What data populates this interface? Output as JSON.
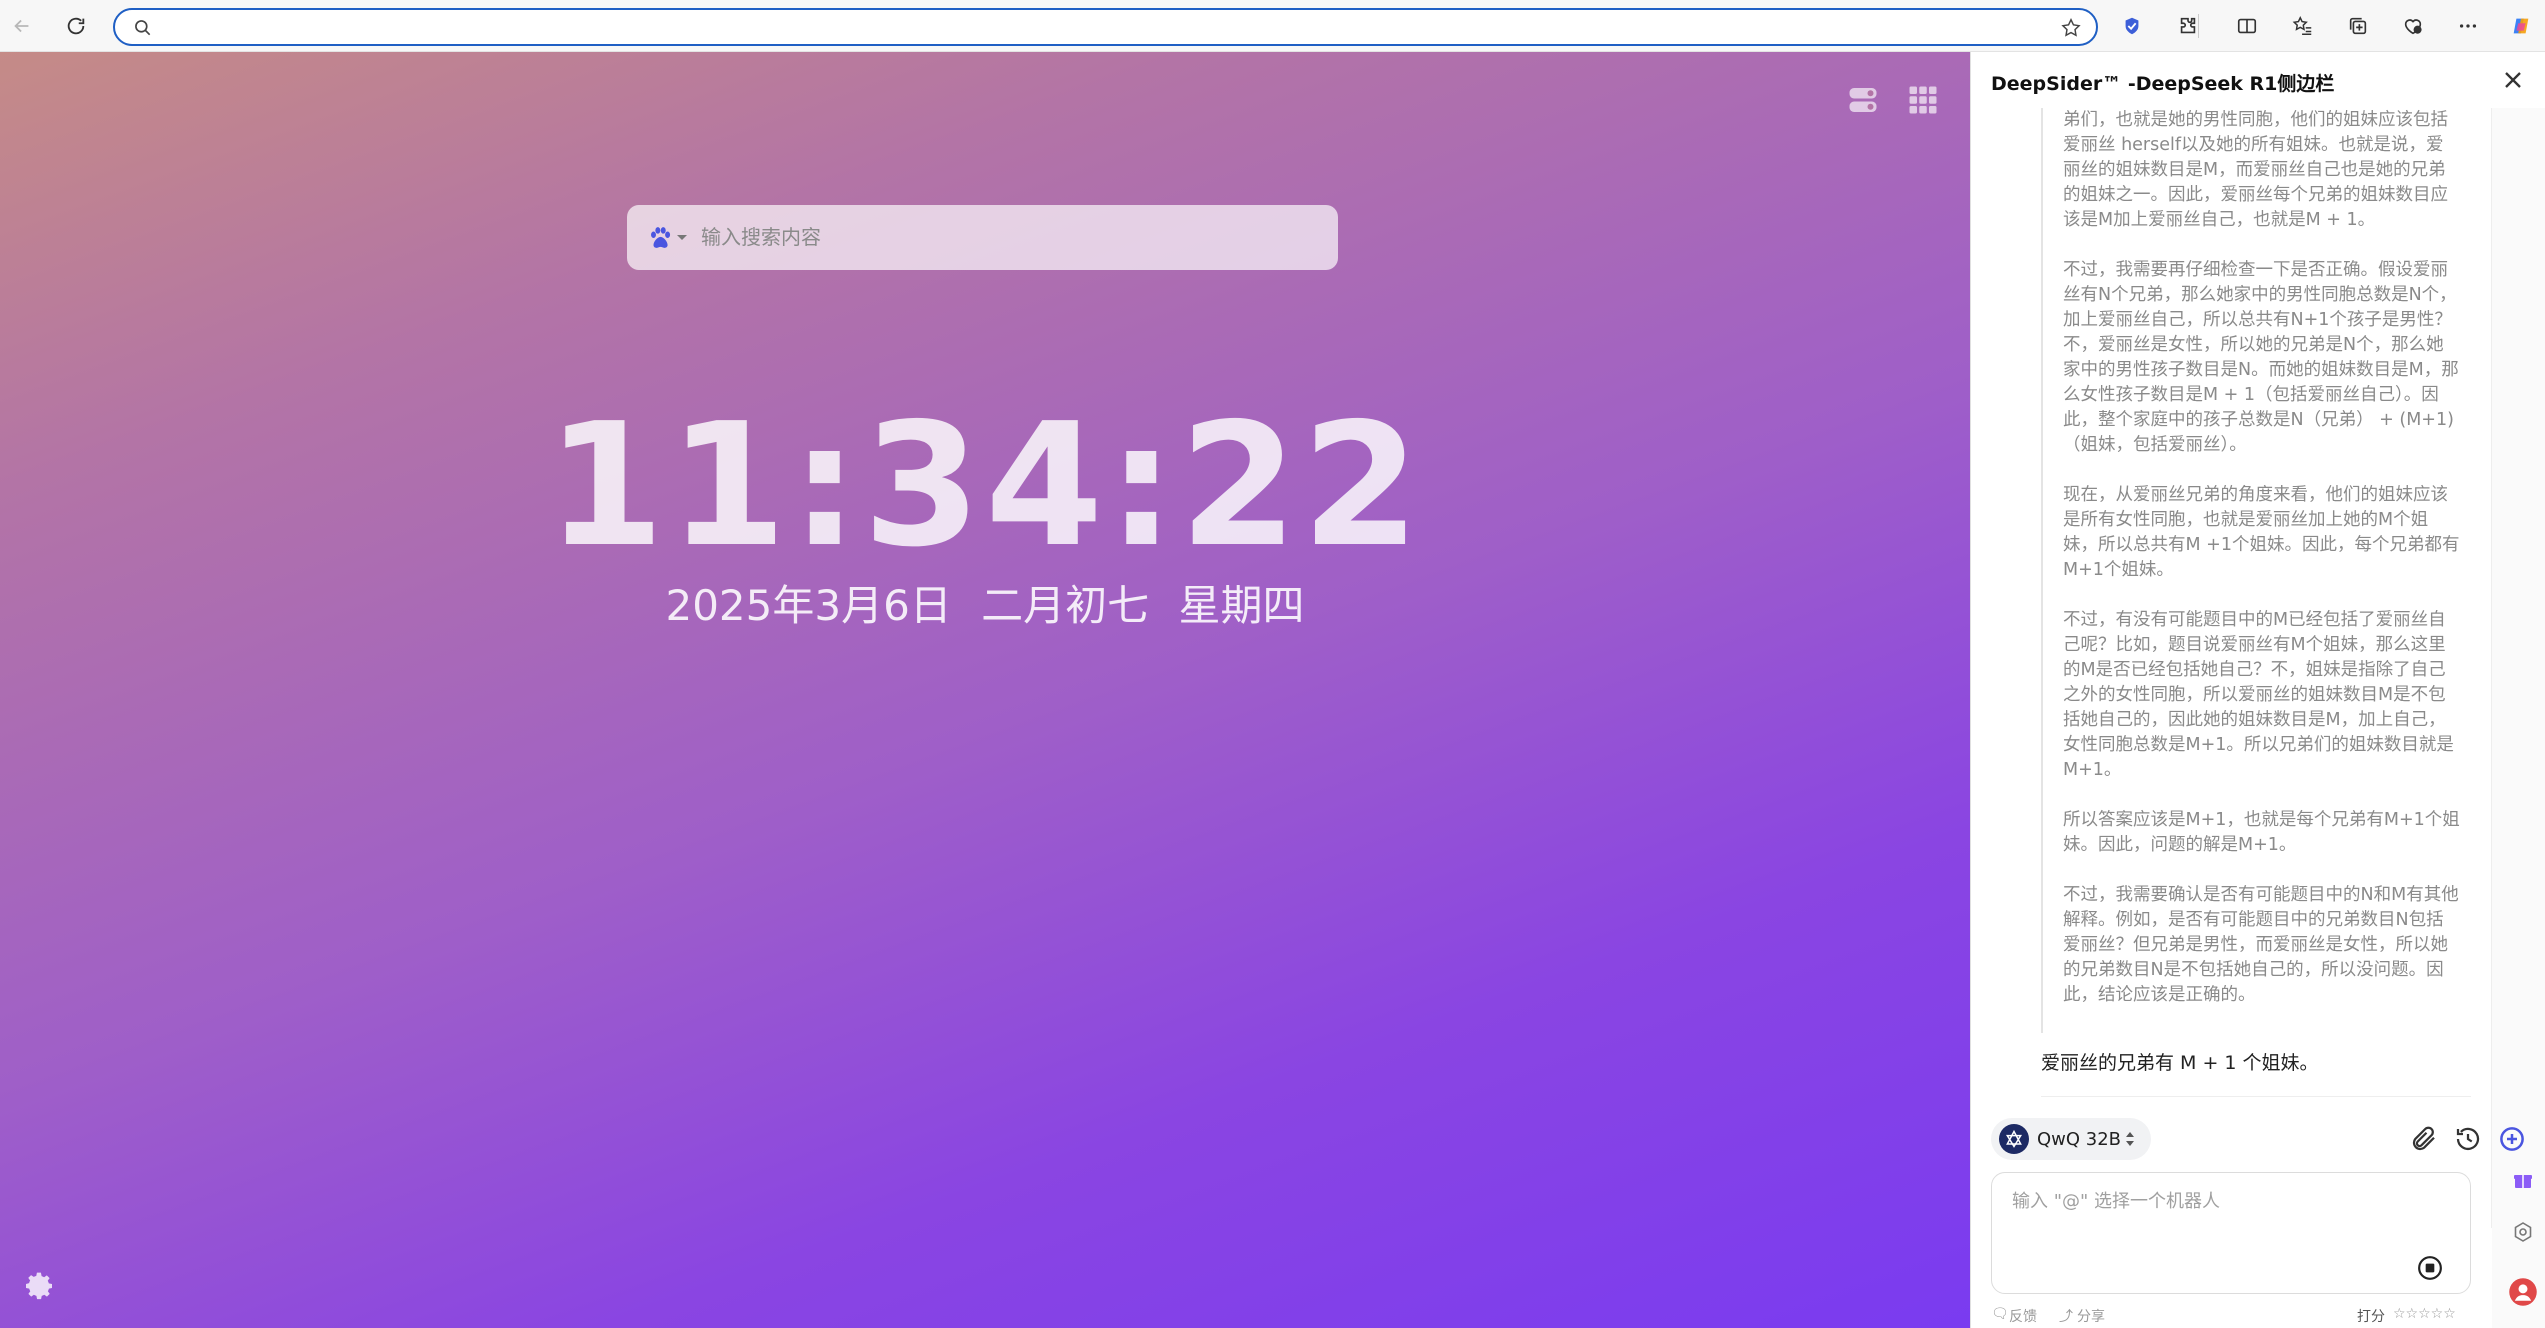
{
  "browser": {
    "address_value": "",
    "address_placeholder": ""
  },
  "newtab": {
    "search_placeholder": "输入搜索内容",
    "clock": "11:34:22",
    "date": "2025年3月6日 二月初七 星期四"
  },
  "panel": {
    "title": "DeepSider™ -DeepSeek R1侧边栏",
    "thinking_paragraphs": [
      "弟们，也就是她的男性同胞，他们的姐妹应该包括爱丽丝 herself以及她的所有姐妹。也就是说，爱丽丝的姐妹数目是M，而爱丽丝自己也是她的兄弟的姐妹之一。因此，爱丽丝每个兄弟的姐妹数目应该是M加上爱丽丝自己，也就是M + 1。",
      "不过，我需要再仔细检查一下是否正确。假设爱丽丝有N个兄弟，那么她家中的男性同胞总数是N个，加上爱丽丝自己，所以总共有N+1个孩子是男性？不，爱丽丝是女性，所以她的兄弟是N个，那么她家中的男性孩子数目是N。而她的姐妹数目是M，那么女性孩子数目是M + 1（包括爱丽丝自己）。因此，整个家庭中的孩子总数是N（兄弟） + (M+1)（姐妹，包括爱丽丝）。",
      "现在，从爱丽丝兄弟的角度来看，他们的姐妹应该是所有女性同胞，也就是爱丽丝加上她的M个姐妹，所以总共有M +1个姐妹。因此，每个兄弟都有M+1个姐妹。",
      "不过，有没有可能题目中的M已经包括了爱丽丝自己呢？比如，题目说爱丽丝有M个姐妹，那么这里的M是否已经包括她自己？不，姐妹是指除了自己之外的女性同胞，所以爱丽丝的姐妹数目M是不包括她自己的，因此她的姐妹数目是M，加上自己，女性同胞总数是M+1。所以兄弟们的姐妹数目就是M+1。",
      "所以答案应该是M+1，也就是每个兄弟有M+1个姐妹。因此，问题的解是M+1。",
      "不过，我需要确认是否有可能题目中的N和M有其他解释。例如，是否有可能题目中的兄弟数目N包括爱丽丝？但兄弟是男性，而爱丽丝是女性，所以她的兄弟数目N是不包括她自己的，所以没问题。因此，结论应该是正确的。"
    ],
    "answer": "爱丽丝的兄弟有 M + 1 个姐妹。",
    "model_name": "QwQ 32B",
    "input_placeholder": "输入 \"@\" 选择一个机器人",
    "footer": {
      "feedback": "反馈",
      "share": "分享",
      "rate": "打分",
      "stars": "☆☆☆☆☆"
    }
  },
  "colors": {
    "accent": "#1f5fc4",
    "gradient_top": "#c58b87",
    "gradient_bottom": "#7a3bf0"
  }
}
